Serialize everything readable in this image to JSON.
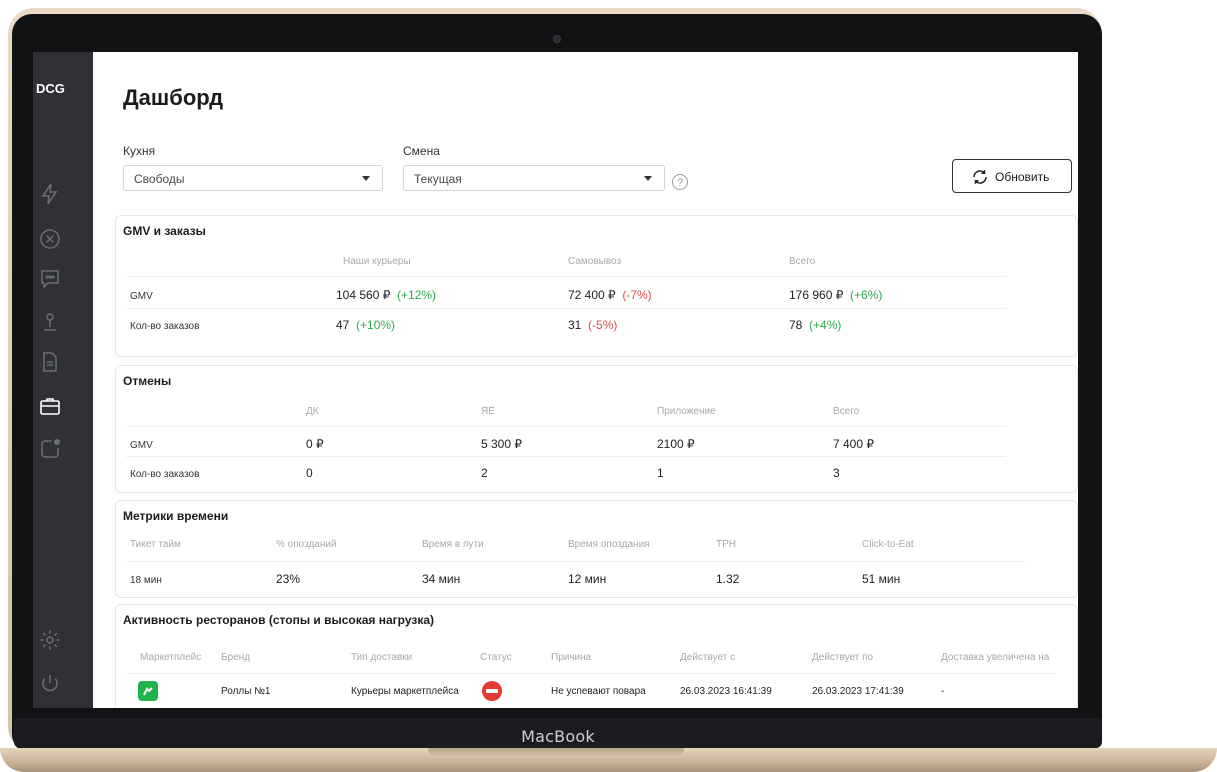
{
  "device": {
    "brand_label": "MacBook"
  },
  "sidebar": {
    "logo": "DCG",
    "items": [
      {
        "icon": "lightning-icon"
      },
      {
        "icon": "close-circle-icon"
      },
      {
        "icon": "chat-icon"
      },
      {
        "icon": "joystick-icon"
      },
      {
        "icon": "document-icon"
      },
      {
        "icon": "briefcase-icon",
        "active": true
      },
      {
        "icon": "notification-icon"
      }
    ],
    "bottom": [
      {
        "icon": "gear-icon"
      },
      {
        "icon": "power-icon"
      }
    ]
  },
  "page": {
    "title": "Дашборд"
  },
  "filters": {
    "kitchen_label": "Кухня",
    "kitchen_value": "Свободы",
    "shift_label": "Смена",
    "shift_value": "Текущая",
    "help": "?",
    "refresh_label": "Обновить"
  },
  "gmv": {
    "title": "GMV и заказы",
    "columns": [
      "Наши курьеры",
      "Самовывоз",
      "Всего"
    ],
    "rows": [
      {
        "label": "GMV",
        "cells": [
          {
            "value": "104 560 ₽",
            "delta": "(+12%)"
          },
          {
            "value": "72 400 ₽",
            "delta": "(-7%)"
          },
          {
            "value": "176 960 ₽",
            "delta": "(+6%)"
          }
        ]
      },
      {
        "label": "Кол-во заказов",
        "cells": [
          {
            "value": "47",
            "delta": "(+10%)"
          },
          {
            "value": "31",
            "delta": "(-5%)"
          },
          {
            "value": "78",
            "delta": "(+4%)"
          }
        ]
      }
    ]
  },
  "cancels": {
    "title": "Отмены",
    "columns": [
      "ДК",
      "ЯЕ",
      "Приложение",
      "Всего"
    ],
    "rows": [
      {
        "label": "GMV",
        "cells": [
          "0 ₽",
          "5 300 ₽",
          "2100 ₽",
          "7 400 ₽"
        ]
      },
      {
        "label": "Кол-во заказов",
        "cells": [
          "0",
          "2",
          "1",
          "3"
        ]
      }
    ]
  },
  "time_metrics": {
    "title": "Метрики времени",
    "columns": [
      "Тикет тайм",
      "% опозданий",
      "Время в пути",
      "Время опоздания",
      "TPH",
      "Click-to-Eat"
    ],
    "values": [
      "18 мин",
      "23%",
      "34 мин",
      "12 мин",
      "1.32",
      "51 мин"
    ]
  },
  "activity": {
    "title": "Активность ресторанов (стопы и высокая нагрузка)",
    "columns": [
      "Маркетплейс",
      "Бренд",
      "Тип доставки",
      "Статус",
      "Причина",
      "Действует с",
      "Действует по",
      "Доставка увеличена на"
    ],
    "rows": [
      {
        "marketplace_icon": "marketplace-icon",
        "brand": "Роллы №1",
        "delivery": "Курьеры маркетплейса",
        "status_icon": "stop-icon",
        "reason": "Не успевают повара",
        "from": "26.03.2023 16:41:39",
        "to": "26.03.2023 17:41:39",
        "increase": "-"
      }
    ]
  }
}
